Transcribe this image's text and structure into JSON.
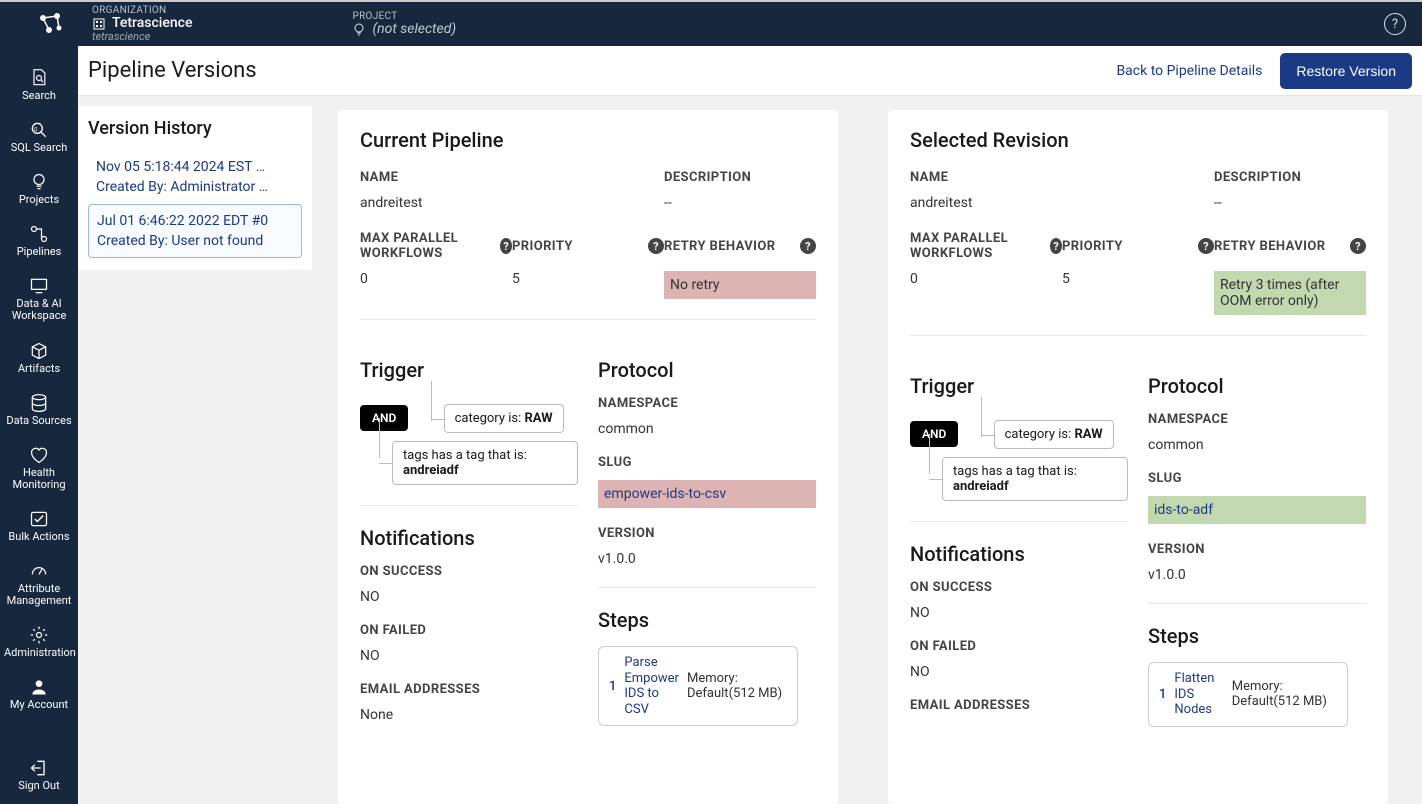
{
  "header": {
    "org_label": "ORGANIZATION",
    "org_name": "Tetrascience",
    "org_sub": "tetrascience",
    "project_label": "PROJECT",
    "project_value": "(not selected)"
  },
  "nav": [
    {
      "icon": "search-doc",
      "label": "Search"
    },
    {
      "icon": "sql",
      "label": "SQL Search"
    },
    {
      "icon": "bulb",
      "label": "Projects"
    },
    {
      "icon": "pipe",
      "label": "Pipelines"
    },
    {
      "icon": "monitor",
      "label": "Data & AI Workspace"
    },
    {
      "icon": "cube",
      "label": "Artifacts"
    },
    {
      "icon": "db",
      "label": "Data Sources"
    },
    {
      "icon": "heart",
      "label": "Health Monitoring"
    },
    {
      "icon": "bulk",
      "label": "Bulk Actions"
    },
    {
      "icon": "gauge",
      "label": "Attribute Management"
    },
    {
      "icon": "gear",
      "label": "Administration"
    },
    {
      "icon": "user",
      "label": "My Account"
    }
  ],
  "nav_signout": {
    "icon": "signout",
    "label": "Sign Out"
  },
  "page": {
    "title": "Pipeline Versions",
    "back": "Back to Pipeline Details",
    "restore": "Restore Version"
  },
  "history": {
    "title": "Version History",
    "items": [
      {
        "date": "Nov 05 5:18:44 2024 EST …",
        "by": "Created By: Administrator …",
        "selected": false
      },
      {
        "date": "Jul 01 6:46:22 2022 EDT #0",
        "by": "Created By: User not found",
        "selected": true
      }
    ]
  },
  "labels": {
    "name": "NAME",
    "desc": "DESCRIPTION",
    "maxpar": "MAX PARALLEL WORKFLOWS",
    "priority": "PRIORITY",
    "retry": "RETRY BEHAVIOR",
    "trigger": "Trigger",
    "protocol": "Protocol",
    "namespace": "NAMESPACE",
    "slug": "SLUG",
    "version": "VERSION",
    "notifications": "Notifications",
    "onsuccess": "ON SUCCESS",
    "onfailed": "ON FAILED",
    "emails": "EMAIL ADDRESSES",
    "and": "AND",
    "steps": "Steps"
  },
  "current": {
    "title": "Current Pipeline",
    "name": "andreitest",
    "desc": "--",
    "maxpar": "0",
    "priority": "5",
    "retry": "No retry",
    "triggers": {
      "cond1_pre": "category is: ",
      "cond1_b": "RAW",
      "cond2_pre": "tags has a tag that is: ",
      "cond2_b": "andreiadf"
    },
    "protocol": {
      "namespace": "common",
      "slug": "empower-ids-to-csv",
      "version": "v1.0.0"
    },
    "notify": {
      "success": "NO",
      "failed": "NO",
      "emails": "None"
    },
    "step": {
      "num": "1",
      "name": "Parse Empower IDS to CSV",
      "mem": "Memory: Default(512 MB)"
    }
  },
  "revision": {
    "title": "Selected Revision",
    "name": "andreitest",
    "desc": "--",
    "maxpar": "0",
    "priority": "5",
    "retry": "Retry 3 times (after OOM error only)",
    "triggers": {
      "cond1_pre": "category is: ",
      "cond1_b": "RAW",
      "cond2_pre": "tags has a tag that is: ",
      "cond2_b": "andreiadf"
    },
    "protocol": {
      "namespace": "common",
      "slug": "ids-to-adf",
      "version": "v1.0.0"
    },
    "notify": {
      "success": "NO",
      "failed": "NO"
    },
    "step": {
      "num": "1",
      "name": "Flatten IDS Nodes",
      "mem": "Memory: Default(512 MB)"
    }
  }
}
